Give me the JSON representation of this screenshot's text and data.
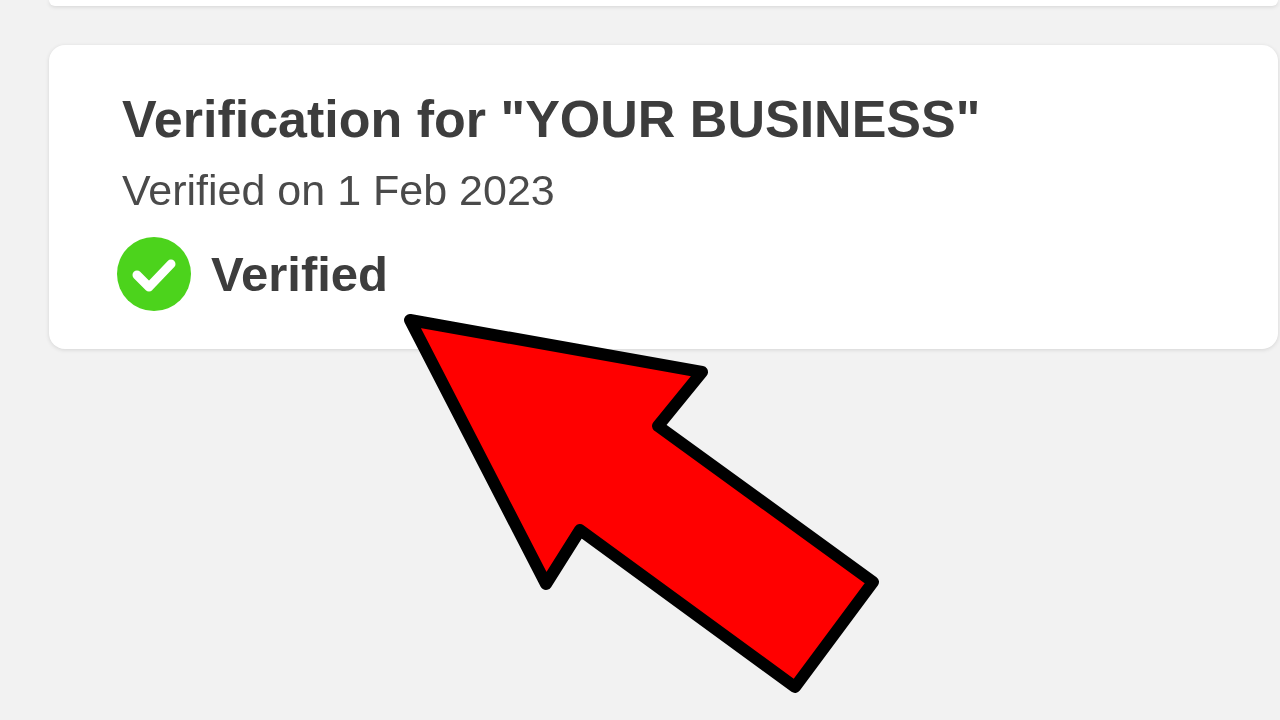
{
  "verification_card": {
    "title": "Verification for \"YOUR BUSINESS\"",
    "subtitle": "Verified on 1 Feb 2023",
    "status": {
      "label": "Verified",
      "verified": true
    }
  }
}
